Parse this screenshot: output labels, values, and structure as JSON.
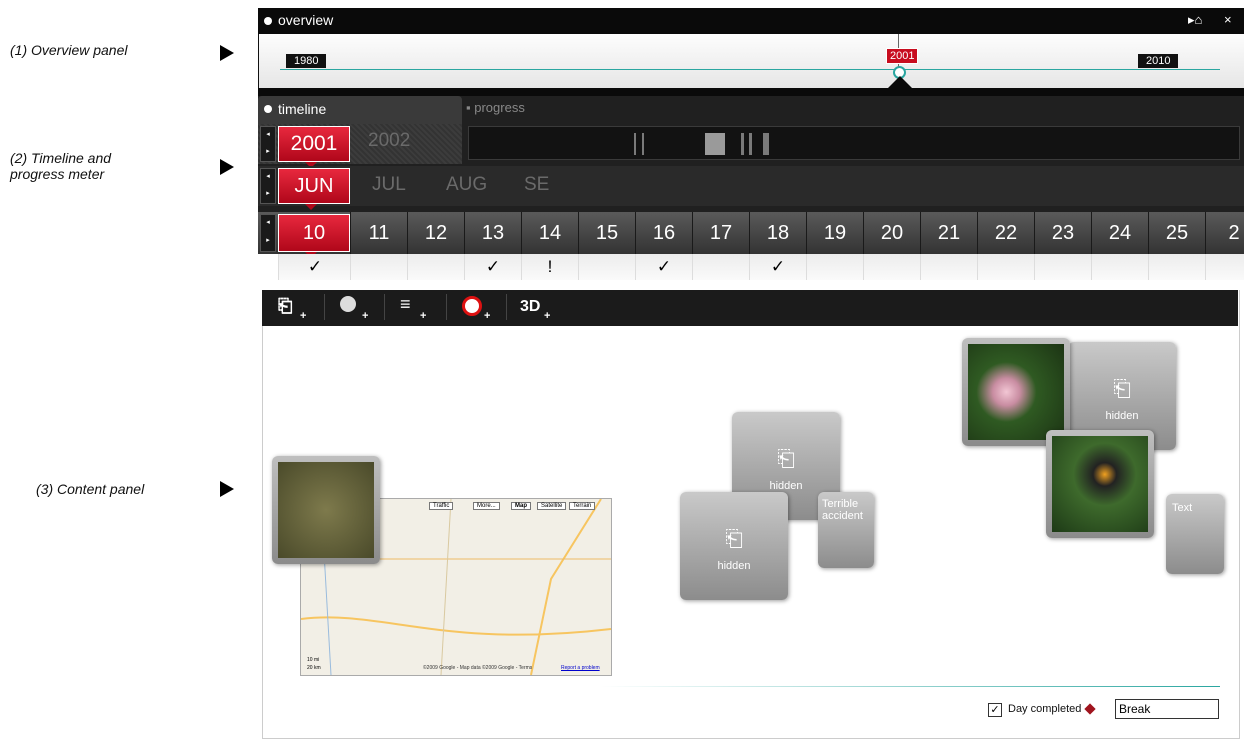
{
  "annotations": [
    {
      "text": "(1) Overview panel"
    },
    {
      "text": "(2) Timeline and\nprogress meter"
    },
    {
      "text": "(3) Content panel"
    }
  ],
  "overview": {
    "title": "overview",
    "controls": {
      "home": "▸🏠",
      "close": "×"
    },
    "start_year": "1980",
    "end_year": "2010",
    "current_year": "2001"
  },
  "timeline": {
    "tab_label": "timeline",
    "progress_label": "progress",
    "selected_year": "2001",
    "next_year": "2002",
    "selected_month": "JUN",
    "other_months": [
      "JUL",
      "AUG",
      "SE"
    ],
    "selected_day": "10",
    "days": [
      "11",
      "12",
      "13",
      "14",
      "15",
      "16",
      "17",
      "18",
      "19",
      "20",
      "21",
      "22",
      "23",
      "24",
      "25",
      "2"
    ],
    "marks": [
      "✓",
      "",
      "",
      "✓",
      "!",
      "",
      "✓",
      "",
      "✓",
      "",
      "",
      "",
      "",
      "",
      "",
      "",
      ""
    ]
  },
  "toolbar": {
    "items": [
      {
        "icon": "add-photo-icon"
      },
      {
        "icon": "add-globe-icon"
      },
      {
        "icon": "add-text-icon"
      },
      {
        "icon": "add-webcam-icon"
      },
      {
        "label": "3D",
        "icon": "add-3d-icon"
      }
    ]
  },
  "content": {
    "cards": [
      {
        "label": "hidden"
      },
      {
        "label": "hidden"
      },
      {
        "label": "Terrible accident"
      },
      {
        "label": "hidden"
      },
      {
        "label": "Text"
      }
    ],
    "map_buttons": [
      "Traffic",
      "More...",
      "Map",
      "Satellite",
      "Terrain"
    ],
    "map_copyright": "©2009 Google - Map data ©2009 Google - Terms",
    "map_report": "Report a problem",
    "map_scale": [
      "10 mi",
      "20 km"
    ],
    "day_completed_label": "Day completed",
    "day_completed_checked": true,
    "break_value": "Break"
  }
}
